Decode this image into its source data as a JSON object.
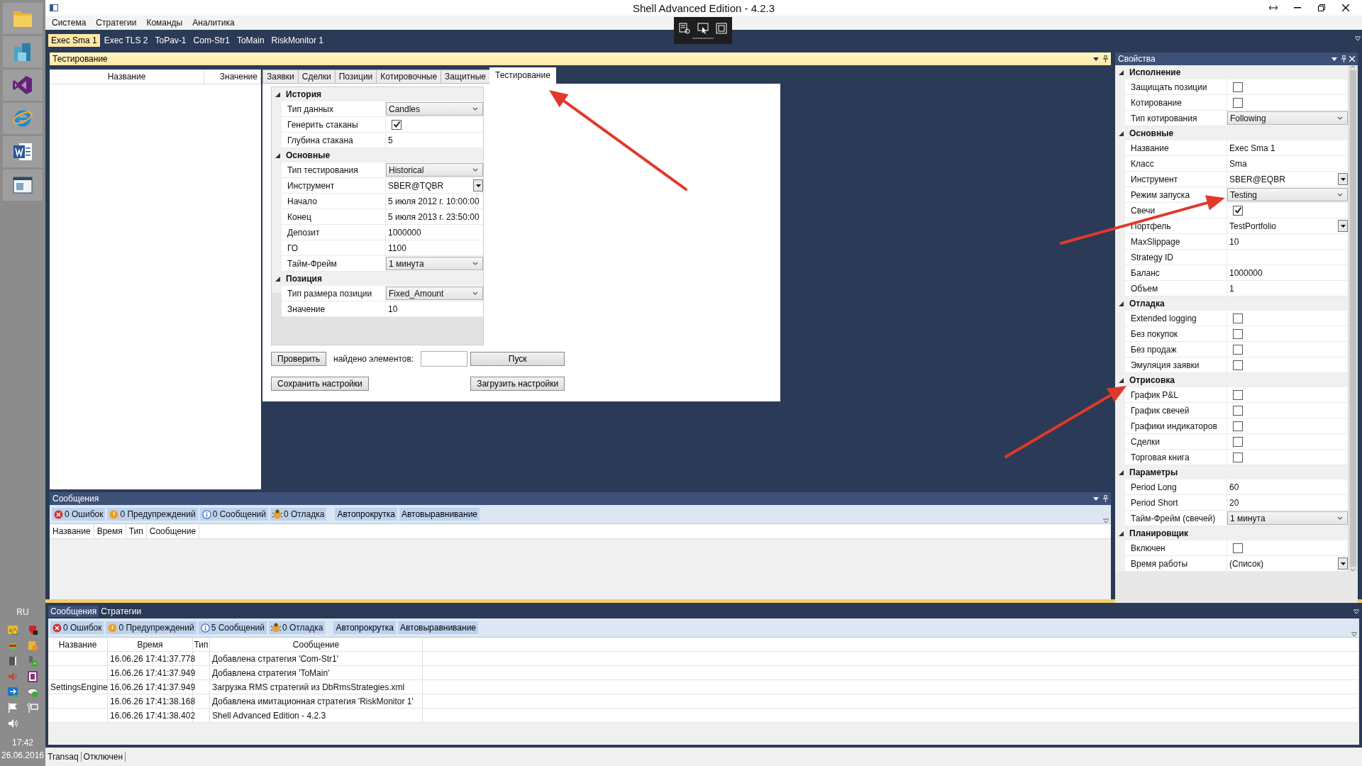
{
  "window": {
    "title": "Shell Advanced Edition - 4.2.3"
  },
  "taskbar": {
    "language": "RU",
    "time": "17:42",
    "date": "26.06.2016"
  },
  "menu": [
    "Система",
    "Стратегии",
    "Команды",
    "Аналитика"
  ],
  "doc_tabs": [
    {
      "label": "Exec Sma 1",
      "selected": true
    },
    {
      "label": "Exec TLS 2",
      "selected": false
    },
    {
      "label": "ToPav-1",
      "selected": false
    },
    {
      "label": "Com-Str1",
      "selected": false
    },
    {
      "label": "ToMain",
      "selected": false
    },
    {
      "label": "RiskMonitor 1",
      "selected": false
    }
  ],
  "testing": {
    "title": "Тестирование",
    "columns": [
      "Название",
      "Значение"
    ],
    "tabs": [
      {
        "label": "Заявки",
        "selected": false
      },
      {
        "label": "Сделки",
        "selected": false
      },
      {
        "label": "Позиции",
        "selected": false
      },
      {
        "label": "Котировочные",
        "selected": false
      },
      {
        "label": "Защитные",
        "selected": false
      },
      {
        "label": "Тестирование",
        "selected": true
      }
    ],
    "sections": [
      {
        "title": "История",
        "rows": [
          {
            "label": "Тип данных",
            "kind": "dropdown",
            "value": "Candles"
          },
          {
            "label": "Генерить стаканы",
            "kind": "check",
            "checked": true
          },
          {
            "label": "Глубина стакана",
            "kind": "text",
            "value": "5"
          }
        ]
      },
      {
        "title": "Основные",
        "rows": [
          {
            "label": "Тип тестирования",
            "kind": "dropdown",
            "value": "Historical"
          },
          {
            "label": "Инструмент",
            "kind": "lookup",
            "value": "SBER@TQBR"
          },
          {
            "label": "Начало",
            "kind": "text",
            "value": "5 июля 2012 г. 10:00:00"
          },
          {
            "label": "Конец",
            "kind": "text",
            "value": "5 июля 2013 г. 23:50:00"
          },
          {
            "label": "Депозит",
            "kind": "text",
            "value": "1000000"
          },
          {
            "label": "ГО",
            "kind": "text",
            "value": "1100"
          },
          {
            "label": "Тайм-Фрейм",
            "kind": "dropdown",
            "value": "1 минута"
          }
        ]
      },
      {
        "title": "Позиция",
        "rows": [
          {
            "label": "Тип размера позиции",
            "kind": "dropdown",
            "value": "Fixed_Amount"
          },
          {
            "label": "Значение",
            "kind": "text",
            "value": "10"
          }
        ]
      }
    ],
    "check_button": "Проверить",
    "found_label": "найдено элементов:",
    "start_button": "Пуск",
    "save_button": "Сохранить настройки",
    "load_button": "Загрузить настройки"
  },
  "properties": {
    "title": "Свойства",
    "sections": [
      {
        "title": "Исполнение",
        "rows": [
          {
            "label": "Защищать позиции",
            "kind": "check",
            "checked": false
          },
          {
            "label": "Котирование",
            "kind": "check",
            "checked": false
          },
          {
            "label": "Тип котирования",
            "kind": "dropdown",
            "value": "Following"
          }
        ]
      },
      {
        "title": "Основные",
        "rows": [
          {
            "label": "Название",
            "kind": "text",
            "value": "Exec Sma 1"
          },
          {
            "label": "Класс",
            "kind": "text",
            "value": "Sma"
          },
          {
            "label": "Инструмент",
            "kind": "lookup",
            "value": "SBER@EQBR"
          },
          {
            "label": "Режим запуска",
            "kind": "dropdown",
            "value": "Testing"
          },
          {
            "label": "Свечи",
            "kind": "check",
            "checked": true
          },
          {
            "label": "Портфель",
            "kind": "lookup",
            "value": "TestPortfolio"
          },
          {
            "label": "MaxSlippage",
            "kind": "text",
            "value": "10"
          },
          {
            "label": "Strategy ID",
            "kind": "text"
          },
          {
            "label": "Баланс",
            "kind": "text",
            "value": "1000000"
          },
          {
            "label": "Объем",
            "kind": "text",
            "value": "1"
          }
        ]
      },
      {
        "title": "Отладка",
        "rows": [
          {
            "label": "Extended logging",
            "kind": "check",
            "checked": false
          },
          {
            "label": "Без покупок",
            "kind": "check",
            "checked": false
          },
          {
            "label": "Без продаж",
            "kind": "check",
            "checked": false
          },
          {
            "label": "Эмуляция заявки",
            "kind": "check",
            "checked": false
          }
        ]
      },
      {
        "title": "Отрисовка",
        "rows": [
          {
            "label": "График P&L",
            "kind": "check",
            "checked": false
          },
          {
            "label": "График свечей",
            "kind": "check",
            "checked": false
          },
          {
            "label": "Графики индикаторов",
            "kind": "check",
            "checked": false
          },
          {
            "label": "Сделки",
            "kind": "check",
            "checked": false
          },
          {
            "label": "Торговая книга",
            "kind": "check",
            "checked": false
          }
        ]
      },
      {
        "title": "Параметры",
        "rows": [
          {
            "label": "Period Long",
            "kind": "text",
            "value": "60"
          },
          {
            "label": "Period Short",
            "kind": "text",
            "value": "20"
          },
          {
            "label": "Тайм-Фрейм (свечей)",
            "kind": "dropdown",
            "value": "1 минута"
          }
        ]
      },
      {
        "title": "Планировщик",
        "rows": [
          {
            "label": "Включен",
            "kind": "check",
            "checked": false
          },
          {
            "label": "Время работы",
            "kind": "lookup",
            "value": "(Список)"
          }
        ]
      }
    ]
  },
  "messages": {
    "title": "Сообщения",
    "filters": [
      {
        "kind": "error",
        "label": "0 Ошибок"
      },
      {
        "kind": "warning",
        "label": "0 Предупреждений"
      },
      {
        "kind": "info",
        "label": "0 Сообщений"
      },
      {
        "kind": "debug",
        "label": "0 Отладка"
      }
    ],
    "toggles": [
      "Автопрокрутка",
      "Автовыравнивание"
    ],
    "columns": [
      "Название",
      "Время",
      "Тип",
      "Сообщение"
    ]
  },
  "log": {
    "tabs": [
      {
        "label": "Сообщения",
        "selected": true
      },
      {
        "label": "Стратегии",
        "selected": false
      }
    ],
    "filters": [
      {
        "kind": "error",
        "label": "0 Ошибок"
      },
      {
        "kind": "warning",
        "label": "0 Предупреждений"
      },
      {
        "kind": "info",
        "label": "5 Сообщений"
      },
      {
        "kind": "debug",
        "label": "0 Отладка"
      }
    ],
    "toggles": [
      "Автопрокрутка",
      "Автовыравнивание"
    ],
    "columns": [
      "Название",
      "Время",
      "Тип",
      "Сообщение"
    ],
    "rows": [
      {
        "time": "16.06.26 17:41:37.778",
        "message": "Добавлена стратегия 'Com-Str1'"
      },
      {
        "time": "16.06.26 17:41:37.949",
        "message": "Добавлена стратегия 'ToMain'"
      },
      {
        "name": "SettingsEngine",
        "time": "16.06.26 17:41:37.949",
        "message": "Загрузка RMS стратегий из DbRmsStrategies.xml"
      },
      {
        "time": "16.06.26 17:41:38.168",
        "message": "Добавлена имитационная стратегия 'RiskMonitor 1'"
      },
      {
        "time": "16.06.26 17:41:38.402",
        "message": "Shell Advanced Edition - 4.2.3"
      }
    ]
  },
  "status_bar": [
    "Transaq",
    "Отключен"
  ]
}
